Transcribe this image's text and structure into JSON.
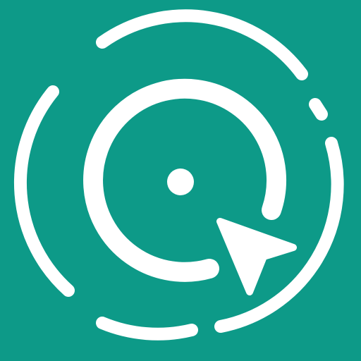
{
  "app_icon": {
    "name": "target-cursor-icon",
    "colors": {
      "background": "#0D9A88",
      "foreground": "#FFFFFF"
    }
  }
}
